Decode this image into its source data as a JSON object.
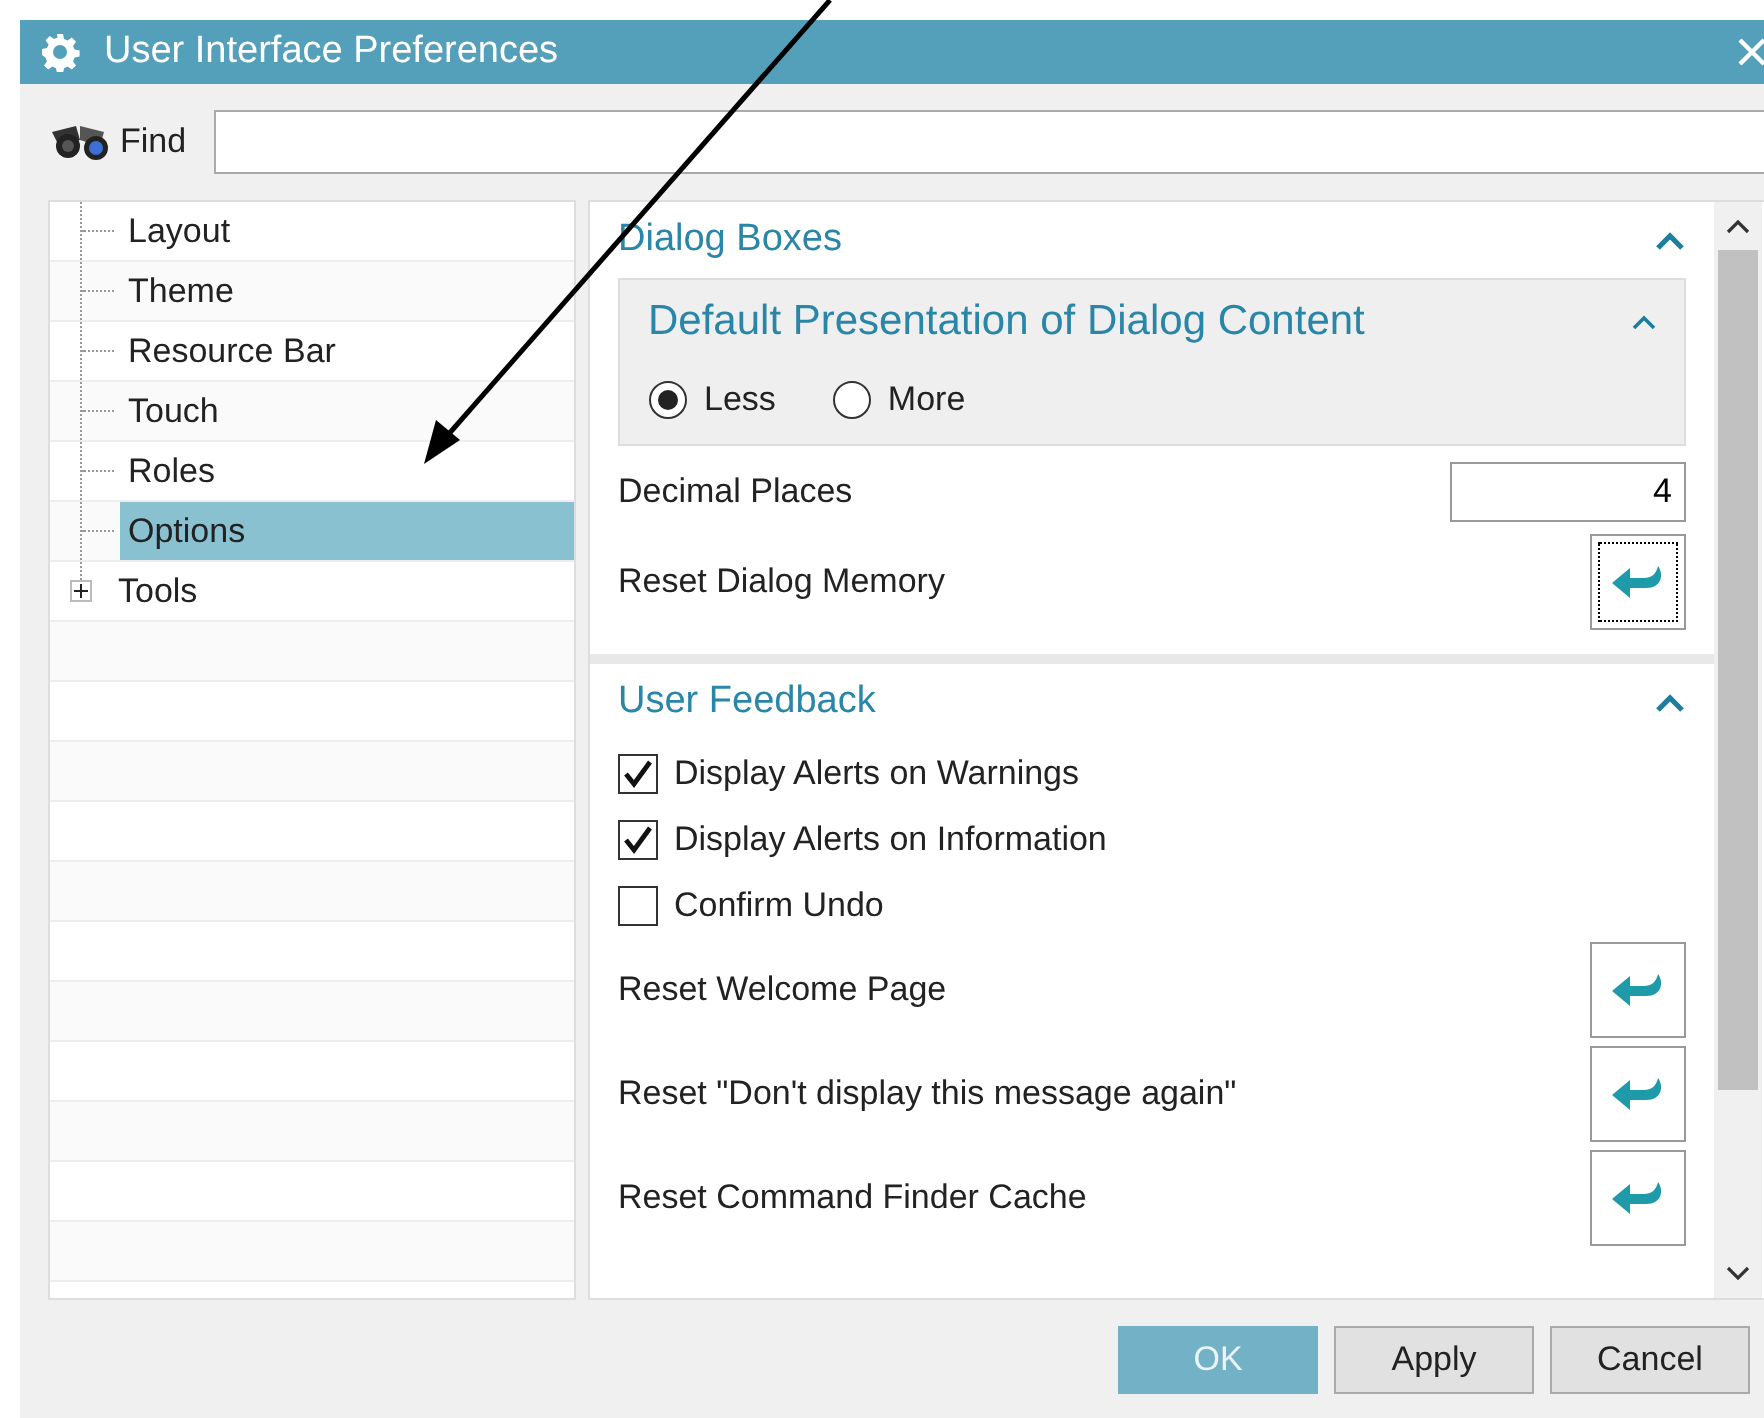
{
  "window": {
    "title": "User Interface Preferences"
  },
  "find": {
    "label": "Find"
  },
  "tree": {
    "items": [
      {
        "label": "Layout",
        "kind": "leaf",
        "selected": false
      },
      {
        "label": "Theme",
        "kind": "leaf",
        "selected": false
      },
      {
        "label": "Resource Bar",
        "kind": "leaf",
        "selected": false
      },
      {
        "label": "Touch",
        "kind": "leaf",
        "selected": false
      },
      {
        "label": "Roles",
        "kind": "leaf",
        "selected": false
      },
      {
        "label": "Options",
        "kind": "leaf",
        "selected": true
      },
      {
        "label": "Tools",
        "kind": "folder",
        "selected": false,
        "expanded": false
      }
    ]
  },
  "sections": [
    {
      "title": "Dialog Boxes",
      "expanded": true,
      "items": [
        {
          "kind": "subgroup",
          "title": "Default Presentation of Dialog Content",
          "expanded": true,
          "options": [
            {
              "label": "Less",
              "selected": true
            },
            {
              "label": "More",
              "selected": false
            }
          ]
        },
        {
          "kind": "number",
          "label": "Decimal Places",
          "value": "4"
        },
        {
          "kind": "reset",
          "label": "Reset Dialog Memory",
          "focused": true
        }
      ]
    },
    {
      "title": "User Feedback",
      "expanded": true,
      "items": [
        {
          "kind": "checkbox",
          "label": "Display Alerts on Warnings",
          "checked": true
        },
        {
          "kind": "checkbox",
          "label": "Display Alerts on Information",
          "checked": true
        },
        {
          "kind": "checkbox",
          "label": "Confirm Undo",
          "checked": false
        },
        {
          "kind": "reset",
          "label": "Reset Welcome Page",
          "focused": false
        },
        {
          "kind": "reset",
          "label": "Reset \"Don't display this message again\"",
          "focused": false
        },
        {
          "kind": "reset",
          "label": "Reset Command Finder Cache",
          "focused": false
        }
      ]
    }
  ],
  "buttons": [
    {
      "label": "OK",
      "kind": "primary"
    },
    {
      "label": "Apply",
      "kind": "normal"
    },
    {
      "label": "Cancel",
      "kind": "normal"
    }
  ]
}
